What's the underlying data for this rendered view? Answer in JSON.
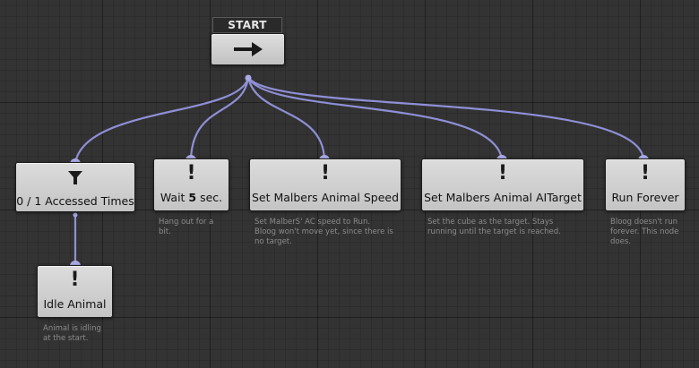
{
  "start": {
    "label": "START",
    "icon": "arrow-right-icon"
  },
  "nodes": {
    "accessed": {
      "title": "0 / 1 Accessed Times",
      "icon": "funnel-icon"
    },
    "idle": {
      "icon_glyph": "!",
      "title": "Idle Animal",
      "description": "Animal is idling\nat the start."
    },
    "wait": {
      "icon_glyph": "!",
      "title_prefix": "Wait ",
      "title_value": "5",
      "title_suffix": " sec.",
      "description": "Hang out for a\nbit."
    },
    "speed": {
      "icon_glyph": "!",
      "title": "Set Malbers Animal Speed",
      "description": "Set MalberS' AC speed to Run.\nBloog won't move yet, since there is\nno target."
    },
    "aitarget": {
      "icon_glyph": "!",
      "title": "Set Malbers Animal AITarget",
      "description": "Set the cube as the target. Stays\nrunning until the target is reached."
    },
    "forever": {
      "icon_glyph": "!",
      "title": "Run Forever",
      "description": "Bloog doesn't run\nforever. This node\ndoes."
    }
  },
  "colors": {
    "edge": "#8f8fd6",
    "node_fill": "#d0d0d0",
    "background": "#333333"
  }
}
